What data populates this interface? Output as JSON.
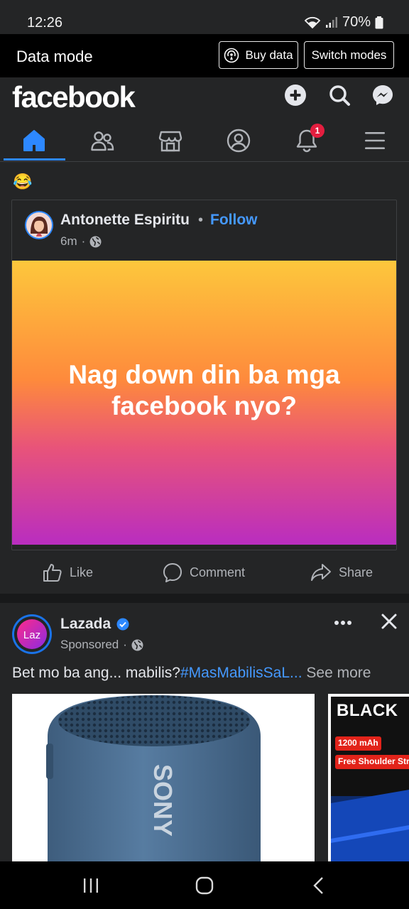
{
  "status_bar": {
    "time": "12:26",
    "battery": "70%"
  },
  "data_mode_bar": {
    "title": "Data mode",
    "buy_data_label": "Buy data",
    "switch_modes_label": "Switch modes"
  },
  "header": {
    "logo": "facebook"
  },
  "tabs": {
    "items": [
      {
        "name": "home"
      },
      {
        "name": "friends"
      },
      {
        "name": "marketplace"
      },
      {
        "name": "profile"
      },
      {
        "name": "notifications"
      },
      {
        "name": "menu"
      }
    ],
    "notification_count": "1",
    "active": "home"
  },
  "post": {
    "reaction_emoji": "😂",
    "author": "Antonette Espiritu",
    "separator": "•",
    "follow_label": "Follow",
    "time": "6m",
    "time_separator": "·",
    "text": "Nag down din ba mga facebook nyo?",
    "gradient_colors": [
      "#fdc73c",
      "#fe8a3c",
      "#e8537a",
      "#b92dc0"
    ]
  },
  "actions": {
    "like": "Like",
    "comment": "Comment",
    "share": "Share"
  },
  "ad": {
    "advertiser": "Lazada",
    "avatar_text": "Laz",
    "sponsored": "Sponsored",
    "meta_separator": "·",
    "text_plain": "Bet mo ba ang... mabilis?",
    "hashtag": "#MasMabilisSaL...",
    "see_more": " See more",
    "card2_title": "BLACK",
    "card2_chip1": "1200 mAh",
    "card2_chip2": "Free Shoulder Str",
    "card1_brand": "SONY"
  },
  "colors": {
    "accent": "#2d88ff",
    "link": "#4599ff",
    "background": "#242526",
    "badge": "#e41e3f"
  }
}
